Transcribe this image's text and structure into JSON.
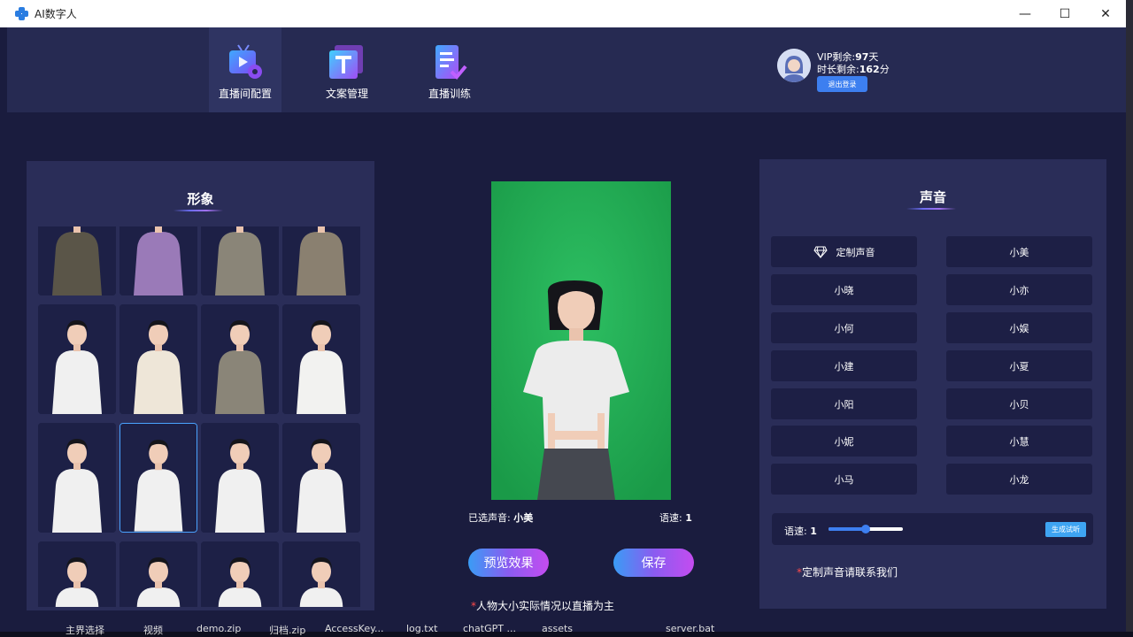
{
  "window": {
    "title": "AI数字人",
    "minimize": "—",
    "maximize": "☐",
    "close": "✕"
  },
  "nav": [
    {
      "label": "直播间配置",
      "icon": "tv-gear-icon",
      "active": true
    },
    {
      "label": "文案管理",
      "icon": "text-t-icon",
      "active": false
    },
    {
      "label": "直播训练",
      "icon": "document-check-icon",
      "active": false
    }
  ],
  "user": {
    "vip_prefix": "VIP剩余:",
    "vip_value": "97",
    "vip_unit": "天",
    "time_prefix": "时长剩余:",
    "time_value": "162",
    "time_unit": "分",
    "logout_label": "退出登录"
  },
  "avatars": {
    "title": "形象",
    "selected_index": 9
  },
  "preview": {
    "voice_label": "已选声音:",
    "voice_value": "小美",
    "speed_label": "语速:",
    "speed_value": "1",
    "preview_button": "预览效果",
    "save_button": "保存",
    "note": "人物大小实际情况以直播为主"
  },
  "voices": {
    "title": "声音",
    "custom_label": "定制声音",
    "items": [
      "小美",
      "小晓",
      "小亦",
      "小何",
      "小娱",
      "小建",
      "小夏",
      "小阳",
      "小贝",
      "小妮",
      "小慧",
      "小马",
      "小龙"
    ],
    "speed_label": "语速:",
    "speed_value": "1",
    "speed_level": 0.5,
    "generate_button": "生成试听",
    "note": "定制声音请联系我们"
  },
  "taskbar": [
    "主界选择",
    "视频",
    "demo.zip",
    "归档.zip",
    "AccessKey...",
    "log.txt",
    "chatGPT ...",
    "assets",
    "server.bat"
  ],
  "colors": {
    "accent_blue": "#3d7ff0",
    "green_screen": "#22ad55",
    "panel": "#2a2d58",
    "background": "#1a1c3e"
  }
}
